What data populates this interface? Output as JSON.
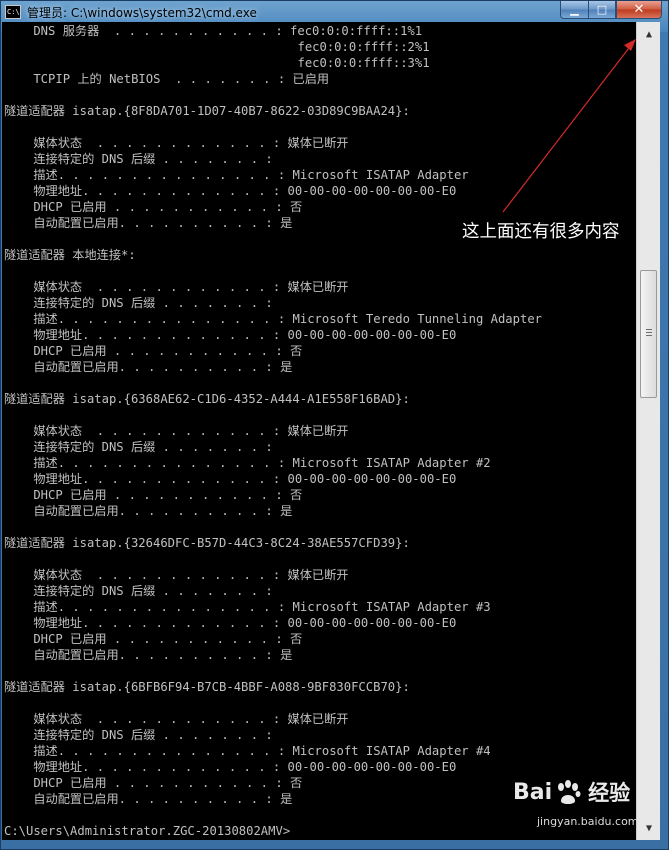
{
  "window": {
    "title": "管理员: C:\\windows\\system32\\cmd.exe",
    "icon_text": "C:\\",
    "minimize_glyph": "▁",
    "maximize_glyph": "□",
    "close_glyph": "✕"
  },
  "console": {
    "lines": [
      "    DNS 服务器  . . . . . . . . . . . : fec0:0:0:ffff::1%1",
      "                                        fec0:0:0:ffff::2%1",
      "                                        fec0:0:0:ffff::3%1",
      "    TCPIP 上的 NetBIOS  . . . . . . . : 已启用",
      "",
      "隧道适配器 isatap.{8F8DA701-1D07-40B7-8622-03D89C9BAA24}:",
      "",
      "    媒体状态  . . . . . . . . . . . . : 媒体已断开",
      "    连接特定的 DNS 后缀 . . . . . . . :",
      "    描述. . . . . . . . . . . . . . . : Microsoft ISATAP Adapter",
      "    物理地址. . . . . . . . . . . . . : 00-00-00-00-00-00-00-E0",
      "    DHCP 已启用 . . . . . . . . . . . : 否",
      "    自动配置已启用. . . . . . . . . . : 是",
      "",
      "隧道适配器 本地连接*:",
      "",
      "    媒体状态  . . . . . . . . . . . . : 媒体已断开",
      "    连接特定的 DNS 后缀 . . . . . . . :",
      "    描述. . . . . . . . . . . . . . . : Microsoft Teredo Tunneling Adapter",
      "    物理地址. . . . . . . . . . . . . : 00-00-00-00-00-00-00-E0",
      "    DHCP 已启用 . . . . . . . . . . . : 否",
      "    自动配置已启用. . . . . . . . . . : 是",
      "",
      "隧道适配器 isatap.{6368AE62-C1D6-4352-A444-A1E558F16BAD}:",
      "",
      "    媒体状态  . . . . . . . . . . . . : 媒体已断开",
      "    连接特定的 DNS 后缀 . . . . . . . :",
      "    描述. . . . . . . . . . . . . . . : Microsoft ISATAP Adapter #2",
      "    物理地址. . . . . . . . . . . . . : 00-00-00-00-00-00-00-E0",
      "    DHCP 已启用 . . . . . . . . . . . : 否",
      "    自动配置已启用. . . . . . . . . . : 是",
      "",
      "隧道适配器 isatap.{32646DFC-B57D-44C3-8C24-38AE557CFD39}:",
      "",
      "    媒体状态  . . . . . . . . . . . . : 媒体已断开",
      "    连接特定的 DNS 后缀 . . . . . . . :",
      "    描述. . . . . . . . . . . . . . . : Microsoft ISATAP Adapter #3",
      "    物理地址. . . . . . . . . . . . . : 00-00-00-00-00-00-00-E0",
      "    DHCP 已启用 . . . . . . . . . . . : 否",
      "    自动配置已启用. . . . . . . . . . : 是",
      "",
      "隧道适配器 isatap.{6BFB6F94-B7CB-4BBF-A088-9BF830FCCB70}:",
      "",
      "    媒体状态  . . . . . . . . . . . . : 媒体已断开",
      "    连接特定的 DNS 后缀 . . . . . . . :",
      "    描述. . . . . . . . . . . . . . . : Microsoft ISATAP Adapter #4",
      "    物理地址. . . . . . . . . . . . . : 00-00-00-00-00-00-00-E0",
      "    DHCP 已启用 . . . . . . . . . . . : 否",
      "    自动配置已启用. . . . . . . . . . : 是",
      "",
      "C:\\Users\\Administrator.ZGC-20130802AMV>"
    ]
  },
  "scrollbar": {
    "up_glyph": "▲",
    "down_glyph": "▼"
  },
  "annotation": {
    "text": "这上面还有很多内容",
    "arrow_color": "#d42a2a"
  },
  "watermark": {
    "brand_left": "Bai",
    "brand_right": "经验",
    "url": "jingyan.baidu.com"
  }
}
